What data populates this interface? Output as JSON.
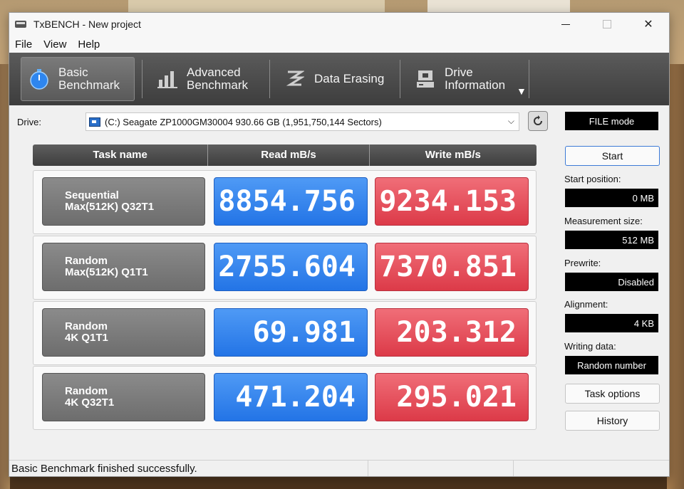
{
  "window": {
    "title": "TxBENCH - New project",
    "controls": {
      "minimize": "min-icon",
      "maximize": "max-icon",
      "close": "✕"
    }
  },
  "menu": [
    "File",
    "View",
    "Help"
  ],
  "toolbar": {
    "tabs": [
      {
        "line1": "Basic",
        "line2": "Benchmark",
        "icon": "stopwatch-icon"
      },
      {
        "line1": "Advanced",
        "line2": "Benchmark",
        "icon": "bar-chart-icon"
      },
      {
        "line1": "Data Erasing",
        "line2": "",
        "icon": "erase-icon"
      },
      {
        "line1": "Drive",
        "line2": "Information",
        "icon": "drive-info-icon"
      }
    ],
    "more": "▼"
  },
  "drive": {
    "label": "Drive:",
    "selected": "(C:) Seagate ZP1000GM30004  930.66 GB (1,951,750,144 Sectors)",
    "mode": "FILE mode"
  },
  "grid": {
    "headers": [
      "Task name",
      "Read mB/s",
      "Write mB/s"
    ],
    "rows": [
      {
        "task_line1": "Sequential",
        "task_line2": "Max(512K) Q32T1",
        "read": "8854.756",
        "write": "9234.153"
      },
      {
        "task_line1": "Random",
        "task_line2": "Max(512K) Q1T1",
        "read": "2755.604",
        "write": "7370.851"
      },
      {
        "task_line1": "Random",
        "task_line2": "4K Q1T1",
        "read": "69.981",
        "write": "203.312"
      },
      {
        "task_line1": "Random",
        "task_line2": "4K Q32T1",
        "read": "471.204",
        "write": "295.021"
      }
    ]
  },
  "side": {
    "start": "Start",
    "start_position_label": "Start position:",
    "start_position_value": "0 MB",
    "measurement_size_label": "Measurement size:",
    "measurement_size_value": "512 MB",
    "prewrite_label": "Prewrite:",
    "prewrite_value": "Disabled",
    "alignment_label": "Alignment:",
    "alignment_value": "4 KB",
    "writing_data_label": "Writing data:",
    "writing_data_value": "Random number",
    "task_options": "Task options",
    "history": "History"
  },
  "status": {
    "message": "Basic Benchmark finished successfully."
  },
  "colors": {
    "read": "#2f82eb",
    "write": "#e44c58",
    "toolbar": "#4a4a4a"
  }
}
